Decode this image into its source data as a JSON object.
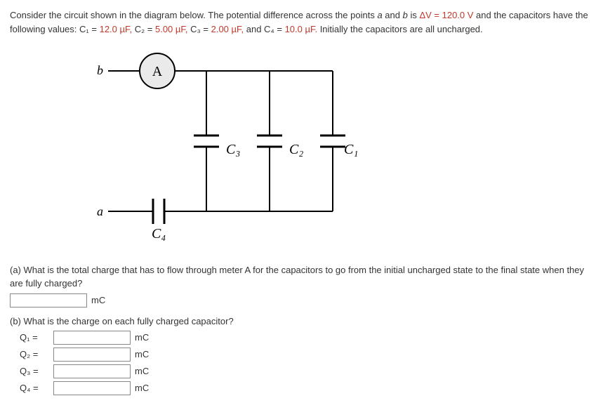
{
  "intro": {
    "t1": "Consider the circuit shown in the diagram below. The potential difference across the points ",
    "a": "a",
    "t2": " and ",
    "b": "b",
    "t3": " is  ",
    "dv_expr": "ΔV = 120.0 V",
    "t4": "  and the capacitors have the following values: ",
    "c1_pre": "C₁ = ",
    "c1_val": "12.0 µF,",
    "c2_pre": "   C₂ = ",
    "c2_val": "5.00 µF,",
    "c3_pre": "   C₃ = ",
    "c3_val": "2.00 µF,",
    "c4_pre": "  and  C₄ = ",
    "c4_val": "10.0 µF.",
    "t5": "  Initially the capacitors are all uncharged."
  },
  "diagram": {
    "b": "b",
    "a": "a",
    "A": "A",
    "C1": "C₁",
    "C2": "C₂",
    "C3": "C₃",
    "C4": "C₄"
  },
  "qA": {
    "text": "(a) What is the total charge that has to flow through meter A for the capacitors to go from the initial uncharged state to the final state when they are fully charged?",
    "unit": "mC"
  },
  "qB": {
    "text": "(b) What is the charge on each fully charged capacitor?",
    "rows": {
      "q1": {
        "label": "Q₁ =",
        "unit": "mC"
      },
      "q2": {
        "label": "Q₂ =",
        "unit": "mC"
      },
      "q3": {
        "label": "Q₃ =",
        "unit": "mC"
      },
      "q4": {
        "label": "Q₄ =",
        "unit": "mC"
      }
    }
  }
}
